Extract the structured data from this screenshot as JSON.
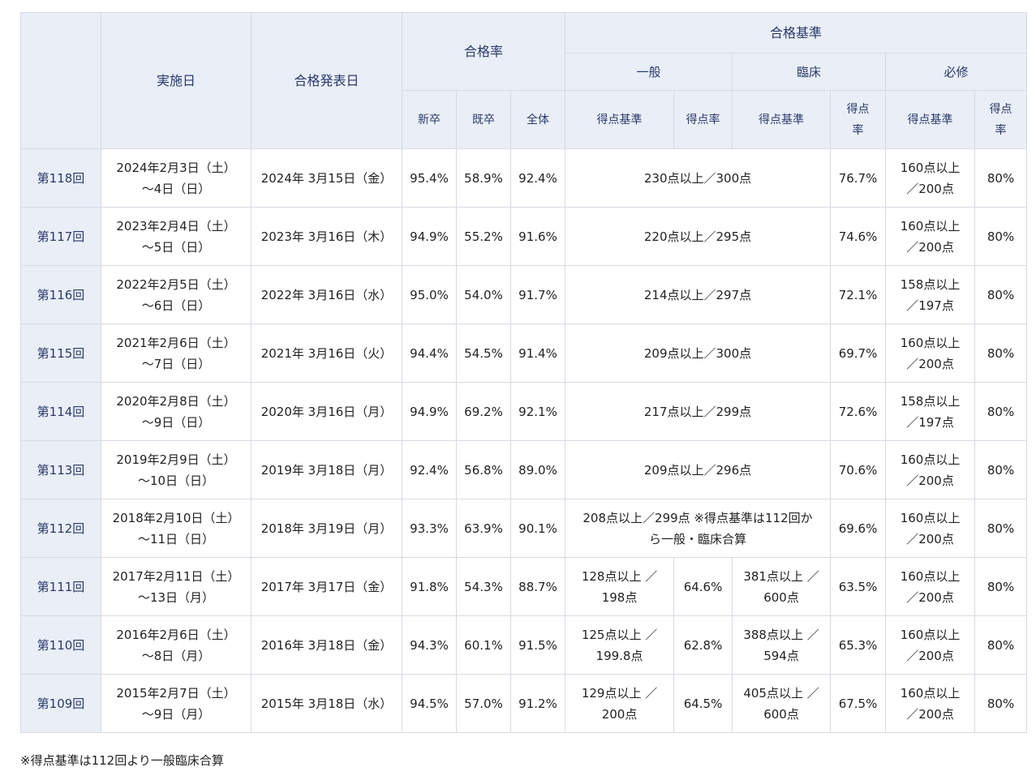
{
  "header": {
    "jisshi": "実施日",
    "happyo": "合格発表日",
    "goukakuritsu": "合格率",
    "kijun": "合格基準",
    "ippan": "一般",
    "rinsho": "臨床",
    "hisshu": "必修",
    "shinsotsu": "新卒",
    "kisotsu": "既卒",
    "zentai": "全体",
    "tokuten_kijun": "得点基準",
    "tokuten_ritsu": "得点率"
  },
  "rows": [
    {
      "round": "第118回",
      "date1": "2024年2月3日（土）",
      "date2": "～4日（日）",
      "pass": "2024年 3月15日（金）",
      "new": "95.4%",
      "old": "58.9%",
      "all": "92.4%",
      "merged": "230点以上／300点",
      "rate": "76.7%",
      "h1": "160点以上",
      "h2": "／200点",
      "hr": "80%"
    },
    {
      "round": "第117回",
      "date1": "2023年2月4日（土）",
      "date2": "～5日（日）",
      "pass": "2023年 3月16日（木）",
      "new": "94.9%",
      "old": "55.2%",
      "all": "91.6%",
      "merged": "220点以上／295点",
      "rate": "74.6%",
      "h1": "160点以上",
      "h2": "／200点",
      "hr": "80%"
    },
    {
      "round": "第116回",
      "date1": "2022年2月5日（土）",
      "date2": "～6日（日）",
      "pass": "2022年 3月16日（水）",
      "new": "95.0%",
      "old": "54.0%",
      "all": "91.7%",
      "merged": "214点以上／297点",
      "rate": "72.1%",
      "h1": "158点以上",
      "h2": "／197点",
      "hr": "80%"
    },
    {
      "round": "第115回",
      "date1": "2021年2月6日（土）",
      "date2": "～7日（日）",
      "pass": "2021年 3月16日（火）",
      "new": "94.4%",
      "old": "54.5%",
      "all": "91.4%",
      "merged": "209点以上／300点",
      "rate": "69.7%",
      "h1": "160点以上",
      "h2": "／200点",
      "hr": "80%"
    },
    {
      "round": "第114回",
      "date1": "2020年2月8日（土）",
      "date2": "～9日（日）",
      "pass": "2020年 3月16日（月）",
      "new": "94.9%",
      "old": "69.2%",
      "all": "92.1%",
      "merged": "217点以上／299点",
      "rate": "72.6%",
      "h1": "158点以上",
      "h2": "／197点",
      "hr": "80%"
    },
    {
      "round": "第113回",
      "date1": "2019年2月9日（土）",
      "date2": "～10日（日）",
      "pass": "2019年 3月18日（月）",
      "new": "92.4%",
      "old": "56.8%",
      "all": "89.0%",
      "merged": "209点以上／296点",
      "rate": "70.6%",
      "h1": "160点以上",
      "h2": "／200点",
      "hr": "80%"
    },
    {
      "round": "第112回",
      "date1": "2018年2月10日（土）",
      "date2": "～11日（日）",
      "pass": "2018年 3月19日（月）",
      "new": "93.3%",
      "old": "63.9%",
      "all": "90.1%",
      "merged1": "208点以上／299点 ※得点基準は112回か",
      "merged2": "ら一般・臨床合算",
      "rate": "69.6%",
      "h1": "160点以上",
      "h2": "／200点",
      "hr": "80%"
    }
  ],
  "split_rows": [
    {
      "round": "第111回",
      "date1": "2017年2月11日（土）",
      "date2": "～13日（月）",
      "pass": "2017年 3月17日（金）",
      "new": "91.8%",
      "old": "54.3%",
      "all": "88.7%",
      "g1": "128点以上 ／",
      "g2": "198点",
      "gr": "64.6%",
      "c1": "381点以上 ／",
      "c2": "600点",
      "cr": "63.5%",
      "h1": "160点以上",
      "h2": "／200点",
      "hr": "80%"
    },
    {
      "round": "第110回",
      "date1": "2016年2月6日（土）",
      "date2": "～8日（月）",
      "pass": "2016年 3月18日（金）",
      "new": "94.3%",
      "old": "60.1%",
      "all": "91.5%",
      "g1": "125点以上 ／",
      "g2": "199.8点",
      "gr": "62.8%",
      "c1": "388点以上 ／",
      "c2": "594点",
      "cr": "65.3%",
      "h1": "160点以上",
      "h2": "／200点",
      "hr": "80%"
    },
    {
      "round": "第109回",
      "date1": "2015年2月7日（土）",
      "date2": "～9日（月）",
      "pass": "2015年 3月18日（水）",
      "new": "94.5%",
      "old": "57.0%",
      "all": "91.2%",
      "g1": "129点以上 ／",
      "g2": "200点",
      "gr": "64.5%",
      "c1": "405点以上 ／",
      "c2": "600点",
      "cr": "67.5%",
      "h1": "160点以上",
      "h2": "／200点",
      "hr": "80%"
    }
  ],
  "note": "※得点基準は112回より一般臨床合算",
  "colors": {
    "header_bg": "#e9eef7",
    "header_text": "#2a3a6b",
    "border": "#d6dbe3"
  }
}
